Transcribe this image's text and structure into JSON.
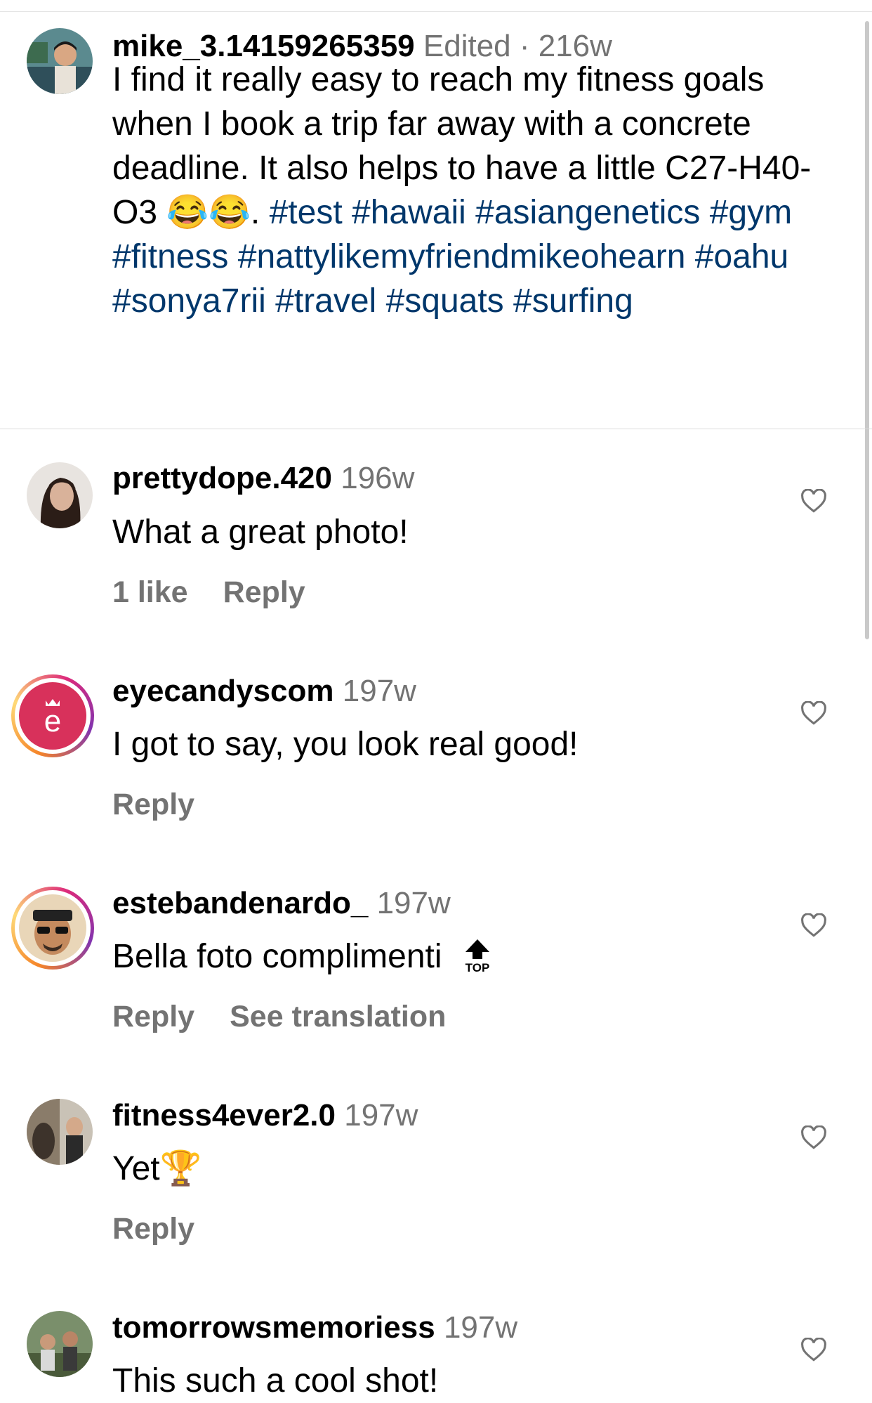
{
  "post": {
    "username": "mike_3.14159265359",
    "meta": "Edited · 216w",
    "caption_text": "I find it really easy to reach my fitness goals when I book a trip far away with a concrete deadline.  It also helps to have a little C27-H40-O3",
    "caption_emoji": "😂😂",
    "caption_end": ".",
    "hashtags": [
      "#test",
      "#hawaii",
      "#asiangenetics",
      "#gym",
      "#fitness",
      "#nattylikemyfriendmikeohearn",
      "#oahu",
      "#sonya7rii",
      "#travel",
      "#squats",
      "#surfing"
    ]
  },
  "comments": [
    {
      "username": "prettydope.420",
      "time": "196w",
      "text": "What a great photo!",
      "likes": "1 like",
      "reply": "Reply",
      "extra": ""
    },
    {
      "username": "eyecandyscom",
      "time": "197w",
      "text": "I got to say, you look real good!",
      "likes": "",
      "reply": "Reply",
      "extra": ""
    },
    {
      "username": "estebandenardo_",
      "time": "197w",
      "text": "Bella foto complimenti",
      "emoji_label": "TOP",
      "likes": "",
      "reply": "Reply",
      "extra": "See translation"
    },
    {
      "username": "fitness4ever2.0",
      "time": "197w",
      "text": "Yet",
      "emoji": "🏆",
      "likes": "",
      "reply": "Reply",
      "extra": ""
    },
    {
      "username": "tomorrowsmemoriess",
      "time": "197w",
      "text": "This such a cool shot!",
      "likes": "",
      "reply": "",
      "extra": ""
    }
  ],
  "icons": {
    "like": "heart-outline-icon",
    "top": "top-arrow-icon"
  },
  "colors": {
    "hashtag": "#00376b",
    "secondary_text": "#737373",
    "story_ring": "#dd2a7b",
    "brand_badge": "#d8315b"
  }
}
